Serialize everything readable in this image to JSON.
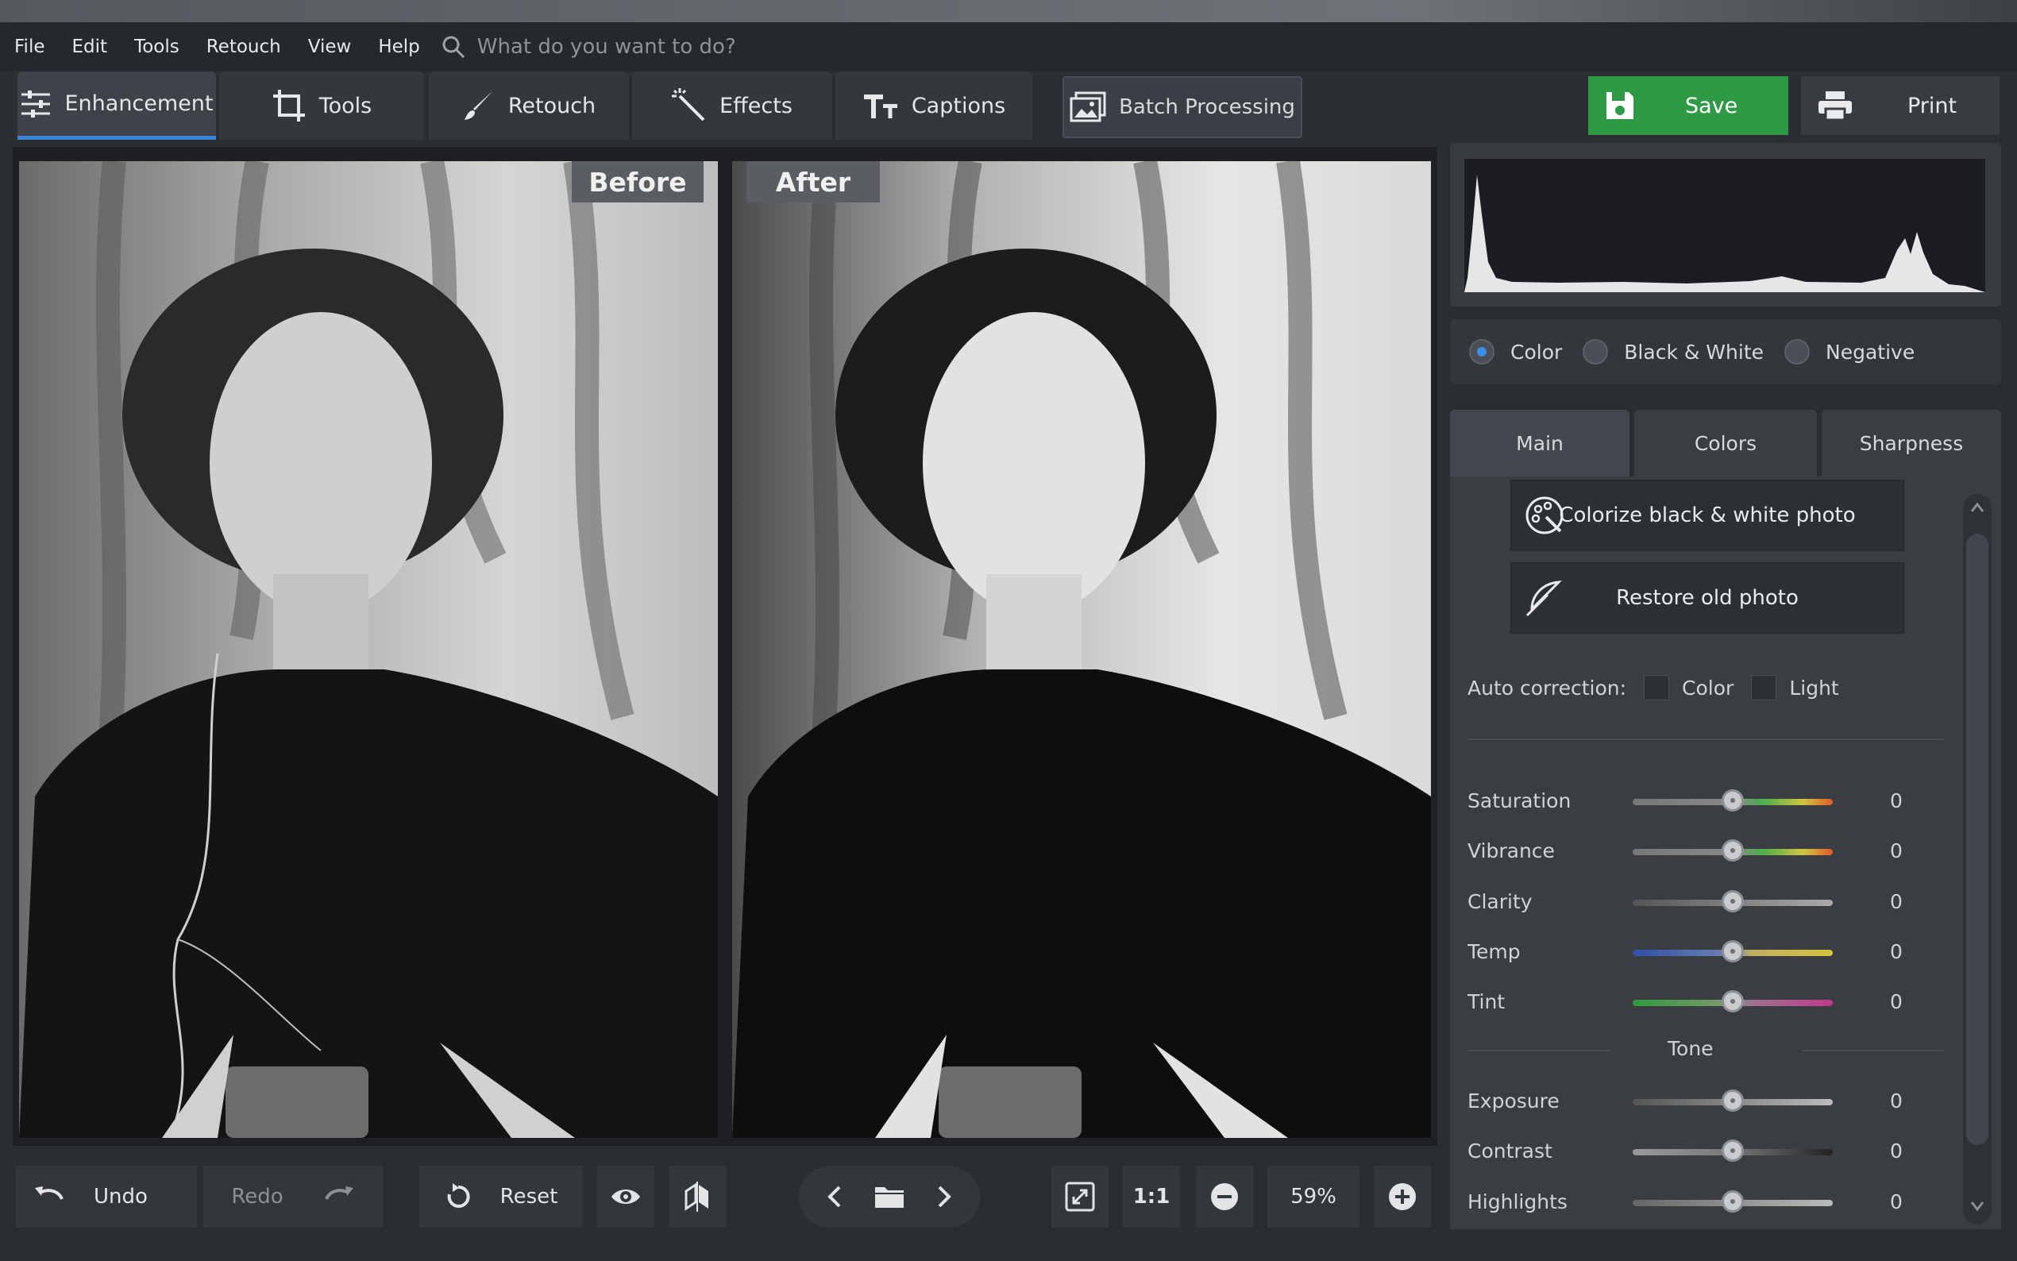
{
  "menu": {
    "file": "File",
    "edit": "Edit",
    "tools": "Tools",
    "retouch": "Retouch",
    "view": "View",
    "help": "Help"
  },
  "search": {
    "placeholder": "What do you want to do?"
  },
  "tabs": {
    "enhancement": "Enhancement",
    "tools": "Tools",
    "retouch": "Retouch",
    "effects": "Effects",
    "captions": "Captions",
    "batch": "Batch Processing"
  },
  "actions": {
    "save": "Save",
    "print": "Print"
  },
  "viewer": {
    "before_label": "Before",
    "after_label": "After"
  },
  "bottom": {
    "undo": "Undo",
    "redo": "Redo",
    "reset": "Reset",
    "one_to_one": "1:1",
    "zoom": "59%"
  },
  "panel": {
    "modes": {
      "color": "Color",
      "bw": "Black & White",
      "negative": "Negative",
      "selected": "Color"
    },
    "subtabs": {
      "main": "Main",
      "colors": "Colors",
      "sharpness": "Sharpness"
    },
    "colorize": "Colorize black & white photo",
    "restore": "Restore old photo",
    "auto_correction": {
      "label": "Auto correction:",
      "color": "Color",
      "light": "Light"
    },
    "tone_heading": "Tone",
    "sliders": {
      "saturation": {
        "label": "Saturation",
        "value": "0"
      },
      "vibrance": {
        "label": "Vibrance",
        "value": "0"
      },
      "clarity": {
        "label": "Clarity",
        "value": "0"
      },
      "temp": {
        "label": "Temp",
        "value": "0"
      },
      "tint": {
        "label": "Tint",
        "value": "0"
      },
      "exposure": {
        "label": "Exposure",
        "value": "0"
      },
      "contrast": {
        "label": "Contrast",
        "value": "0"
      },
      "highlights": {
        "label": "Highlights",
        "value": "0"
      }
    }
  },
  "colors": {
    "accent": "#3c86d6",
    "save": "#2f9a46"
  }
}
